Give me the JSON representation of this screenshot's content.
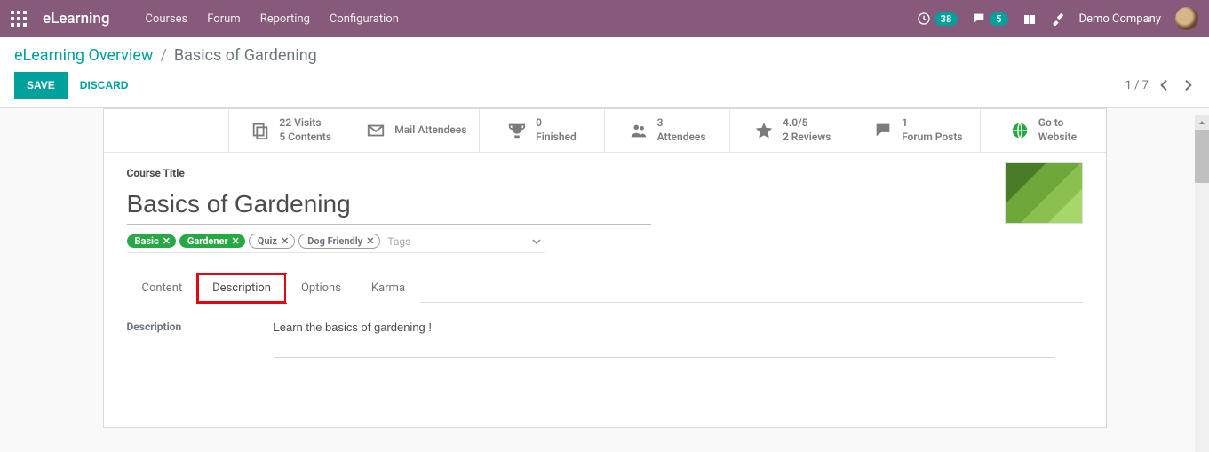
{
  "topbar": {
    "app_title": "eLearning",
    "menu": [
      "Courses",
      "Forum",
      "Reporting",
      "Configuration"
    ],
    "clock_badge": "38",
    "chat_badge": "5",
    "company": "Demo Company"
  },
  "breadcrumb": {
    "root": "eLearning Overview",
    "sep": "/",
    "current": "Basics of Gardening"
  },
  "actions": {
    "save": "Save",
    "discard": "Discard"
  },
  "pager": {
    "text": "1 / 7"
  },
  "stats": {
    "visits": {
      "line1": "22 Visits",
      "line2": "5 Contents"
    },
    "mail": {
      "line1": "Mail Attendees"
    },
    "finished": {
      "line1": "0",
      "line2": "Finished"
    },
    "attendees": {
      "line1": "3",
      "line2": "Attendees"
    },
    "reviews": {
      "line1": "4.0/5",
      "line2": "2 Reviews"
    },
    "forum": {
      "line1": "1",
      "line2": "Forum Posts"
    },
    "website": {
      "line1": "Go to",
      "line2": "Website"
    }
  },
  "course": {
    "title_label": "Course Title",
    "title_value": "Basics of Gardening",
    "tags": {
      "green1": "Basic",
      "green2": "Gardener",
      "outline1": "Quiz",
      "outline2": "Dog Friendly",
      "placeholder": "Tags",
      "x": "✕"
    }
  },
  "tabs": {
    "content": "Content",
    "description": "Description",
    "options": "Options",
    "karma": "Karma"
  },
  "description": {
    "label": "Description",
    "value": "Learn the basics of gardening !"
  }
}
